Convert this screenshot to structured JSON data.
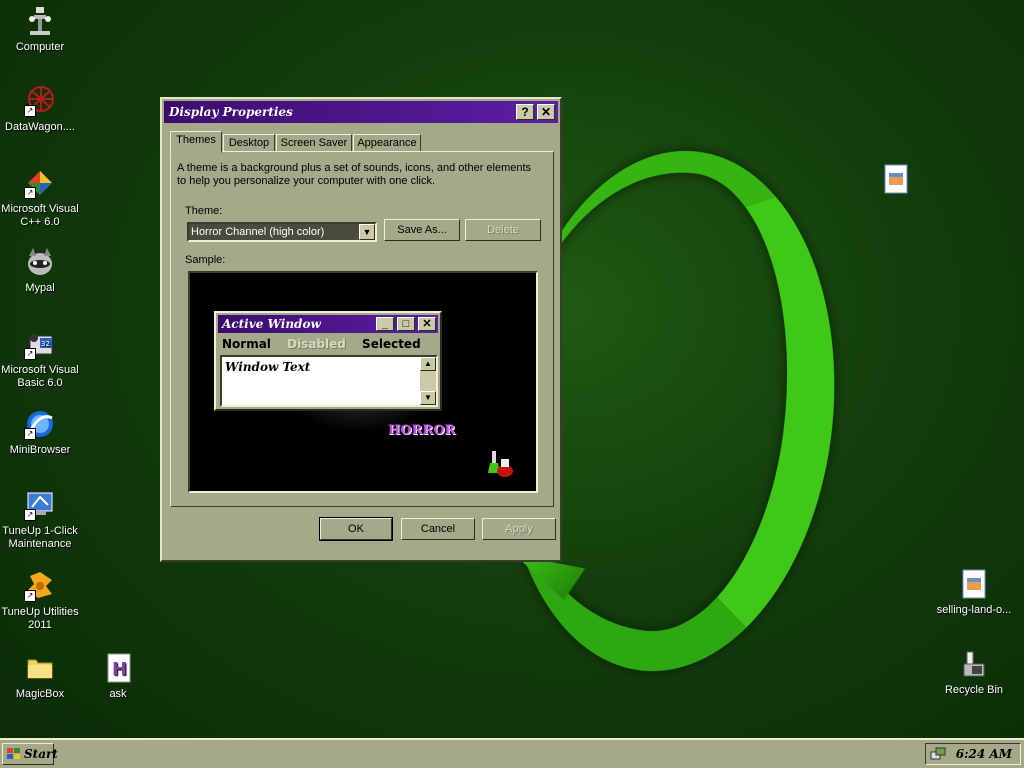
{
  "desktop": {
    "icons": [
      {
        "label": "Computer",
        "icon": "computer-icon"
      },
      {
        "label": "DataWagon....",
        "icon": "datawagon-icon"
      },
      {
        "label": "Microsoft Visual C++ 6.0",
        "icon": "visual-cpp-icon"
      },
      {
        "label": "Mypal",
        "icon": "mypal-icon"
      },
      {
        "label": "Microsoft Visual Basic 6.0",
        "icon": "visual-basic-icon"
      },
      {
        "label": "MiniBrowser",
        "icon": "minibrowser-icon"
      },
      {
        "label": "TuneUp 1-Click Maintenance",
        "icon": "tuneup-maintenance-icon"
      },
      {
        "label": "TuneUp Utilities 2011",
        "icon": "tuneup-utilities-icon"
      },
      {
        "label": "MagicBox",
        "icon": "folder-icon"
      },
      {
        "label": "ask",
        "icon": "ask-file-icon"
      },
      {
        "label": "",
        "icon": "image-file-icon"
      },
      {
        "label": "selling-land-o...",
        "icon": "image-file-icon"
      },
      {
        "label": "Recycle Bin",
        "icon": "recycle-bin-icon"
      }
    ]
  },
  "dialog": {
    "title": "Display Properties",
    "help_btn": "?",
    "close_btn": "✕",
    "tabs": [
      {
        "label": "Themes",
        "active": true
      },
      {
        "label": "Desktop",
        "active": false
      },
      {
        "label": "Screen Saver",
        "active": false
      },
      {
        "label": "Appearance",
        "active": false
      }
    ],
    "description": "A theme is a background plus a set of sounds, icons, and other elements to help you personalize your computer with one click.",
    "theme_label": "Theme:",
    "theme_value": "Horror Channel (high color)",
    "save_as": "Save As...",
    "delete": "Delete",
    "sample_label": "Sample:",
    "sample": {
      "window_title": "Active Window",
      "menu_normal": "Normal",
      "menu_disabled": "Disabled",
      "menu_selected": "Selected",
      "window_text": "Window Text",
      "logo_text": "HORROR"
    },
    "ok": "OK",
    "cancel": "Cancel",
    "apply": "Apply"
  },
  "taskbar": {
    "start_label": "Start",
    "clock": "6:24 AM"
  },
  "colors": {
    "title_gradient_start": "#3b0c6e",
    "title_gradient_end": "#5c1fa3",
    "face": "#a6a88a",
    "desktop": "#123d0b",
    "accent_green": "#3fc817"
  }
}
